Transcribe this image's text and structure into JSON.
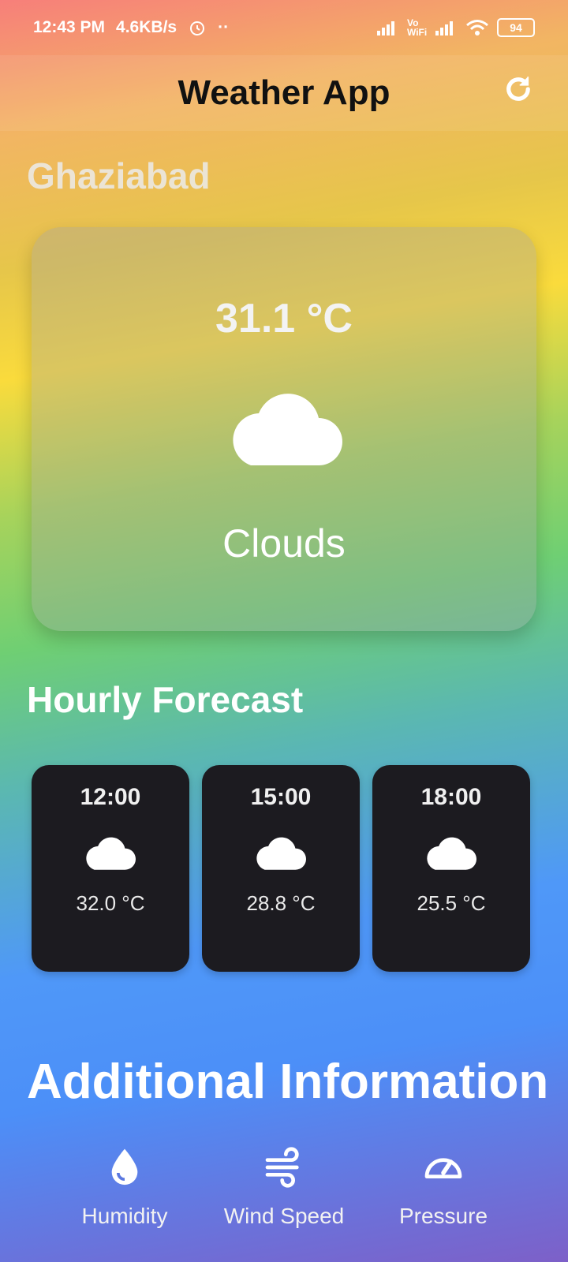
{
  "status_bar": {
    "time": "12:43 PM",
    "speed": "4.6KB/s",
    "dots": "··",
    "battery": "94",
    "wifi_text": "Vo WiFi"
  },
  "app_bar": {
    "title": "Weather App",
    "refresh_icon": "refresh-icon"
  },
  "location": {
    "city": "Ghaziabad"
  },
  "current": {
    "temperature": "31.1 °C",
    "condition": "Clouds",
    "icon": "cloud-icon"
  },
  "hourly": {
    "title": "Hourly Forecast",
    "items": [
      {
        "time": "12:00",
        "temp": "32.0 °C",
        "icon": "cloud-icon"
      },
      {
        "time": "15:00",
        "temp": "28.8 °C",
        "icon": "cloud-icon"
      },
      {
        "time": "18:00",
        "temp": "25.5 °C",
        "icon": "cloud-icon"
      }
    ]
  },
  "additional": {
    "title": "Additional Information",
    "items": [
      {
        "label": "Humidity",
        "value": "",
        "icon": "water-drop-icon"
      },
      {
        "label": "Wind Speed",
        "value": "",
        "icon": "wind-icon"
      },
      {
        "label": "Pressure",
        "value": "",
        "icon": "gauge-icon"
      }
    ]
  },
  "colors": {
    "card_dark": "#1c1b20",
    "title_text": "#111111"
  }
}
